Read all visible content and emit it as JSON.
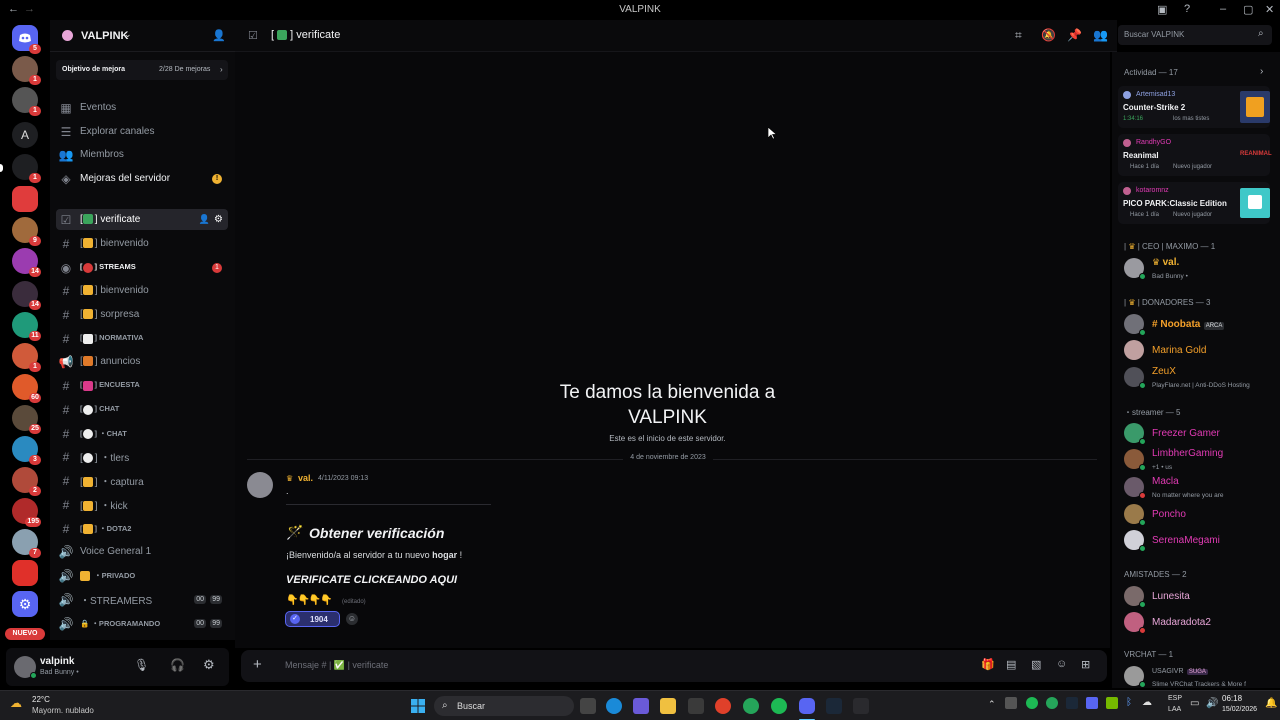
{
  "window": {
    "title": "VALPINK"
  },
  "server": {
    "name": "VALPINK",
    "boost_goal_label": "Objetivo de mejora",
    "boost_goal_value": "2/28 De mejoras",
    "nav": [
      "Eventos",
      "Explorar canales",
      "Miembros",
      "Mejoras del servidor"
    ],
    "new_badge": "NUEVO"
  },
  "rail": {
    "badges": [
      "5",
      "1",
      "1",
      "1",
      "9",
      "14",
      "14",
      "11",
      "1",
      "60",
      "25",
      "3",
      "2",
      "195",
      "7"
    ]
  },
  "channels": [
    {
      "name": "verificate",
      "type": "text",
      "active": true
    },
    {
      "name": "bienvenido",
      "type": "text"
    },
    {
      "name": "STREAMS",
      "type": "stage",
      "unread": true,
      "count": "1"
    },
    {
      "name": "bienvenido",
      "type": "text"
    },
    {
      "name": "sorpresa",
      "type": "text"
    },
    {
      "name": "NORMATIVA",
      "type": "text"
    },
    {
      "name": "anuncios",
      "type": "announce"
    },
    {
      "name": "ENCUESTA",
      "type": "text"
    },
    {
      "name": "CHAT",
      "type": "text"
    },
    {
      "name": "・CHAT",
      "type": "text"
    },
    {
      "name": "・tlers",
      "type": "text"
    },
    {
      "name": "・captura",
      "type": "text"
    },
    {
      "name": "・kick",
      "type": "text"
    },
    {
      "name": "・DOTA2",
      "type": "text"
    },
    {
      "name": "Voice General 1",
      "type": "voice"
    },
    {
      "name": "・PRIVADO",
      "type": "voice"
    },
    {
      "name": "・STREAMERS",
      "type": "voice",
      "count_a": "00",
      "count_b": "99"
    },
    {
      "name": "・PROGRAMANDO",
      "type": "voice",
      "count_a": "00",
      "count_b": "99"
    }
  ],
  "user": {
    "name": "valpink",
    "status": "Bad Bunny •"
  },
  "header": {
    "channel": "verificate",
    "search_placeholder": "Buscar VALPINK"
  },
  "welcome": {
    "title": "Te damos la bienvenida a VALPINK",
    "subtitle": "Este es el inicio de este servidor.",
    "date_divider": "4 de noviembre de 2023"
  },
  "message": {
    "author": "val.",
    "timestamp": "4/11/2023 09:13",
    "dot": ".",
    "heading": "Obtener verificación",
    "line1_prefix": "¡Bienvenido/a al servidor a tu nuevo ",
    "line1_bold": "hogar",
    "line1_suffix": " !",
    "cta": "VERIFICATE CLICKEANDO AQUI",
    "edited": "(editado)",
    "reaction_count": "1904"
  },
  "composer": {
    "placeholder": "Mensaje # | ✅ | verificate"
  },
  "members": {
    "activity_header": "Actividad — 17",
    "activities": [
      {
        "user": "Artemisad13",
        "game": "Counter-Strike 2",
        "detail": "1:34:16",
        "extra": "los mas tistes",
        "user_color": "#8ea1e1"
      },
      {
        "user": "RandhyGO",
        "game": "Reanimal",
        "detail": "Hace 1 día",
        "extra": "Nuevo jugador",
        "user_color": "#e23bb5",
        "logo_text": "REANIMAL"
      },
      {
        "user": "kotaromnz",
        "game": "PICO PARK:Classic Edition",
        "detail": "Hace 1 día",
        "extra": "Nuevo jugador",
        "user_color": "#e23bb5"
      }
    ],
    "groups": [
      {
        "title": "CEO | MAXIMO — 1",
        "items": [
          {
            "name": "val.",
            "sub": "Bad Bunny •",
            "color": "#f0b232"
          }
        ]
      },
      {
        "title": "DONADORES — 3",
        "items": [
          {
            "name": "Noobata",
            "sub": "",
            "color": "#f4a02a",
            "tag": "ARCA"
          },
          {
            "name": "Marina Gold",
            "sub": "",
            "color": "#f4a02a"
          },
          {
            "name": "ZeuX",
            "sub": "PlayFlare.net | Anti-DDoS Hosting",
            "color": "#f4a02a"
          }
        ]
      },
      {
        "title": "streamer — 5",
        "items": [
          {
            "name": "Freezer Gamer",
            "sub": "",
            "color": "#e23bb5"
          },
          {
            "name": "LimbherGaming",
            "sub": "+1 • us",
            "color": "#e23bb5"
          },
          {
            "name": "Macla",
            "sub": "No matter where you are",
            "color": "#e23bb5"
          },
          {
            "name": "Poncho",
            "sub": "",
            "color": "#e23bb5"
          },
          {
            "name": "SerenaMegami",
            "sub": "",
            "color": "#e23bb5"
          }
        ]
      },
      {
        "title": "AMISTADES — 2",
        "items": [
          {
            "name": "Lunesita",
            "sub": "",
            "color": "#e8a6d8"
          },
          {
            "name": "Madaradota2",
            "sub": "",
            "color": "#e8a6d8"
          }
        ]
      },
      {
        "title": "VRCHAT — 1",
        "items": [
          {
            "name": "USAGIVR",
            "sub": "Slime VRChat Trackers & More f",
            "color": "#949ba4",
            "tag": "SUGA"
          }
        ]
      }
    ]
  },
  "taskbar": {
    "weather_temp": "22°C",
    "weather_desc": "Mayorm. nublado",
    "search_label": "Buscar",
    "lang": "ESP",
    "lang_sub": "LAA",
    "time": "06:18",
    "date": "15/02/2026"
  },
  "colors": {
    "accent": "#5865f2",
    "pink": "#e23bb5",
    "red_badge": "#d93a3a",
    "online": "#23a55a"
  }
}
